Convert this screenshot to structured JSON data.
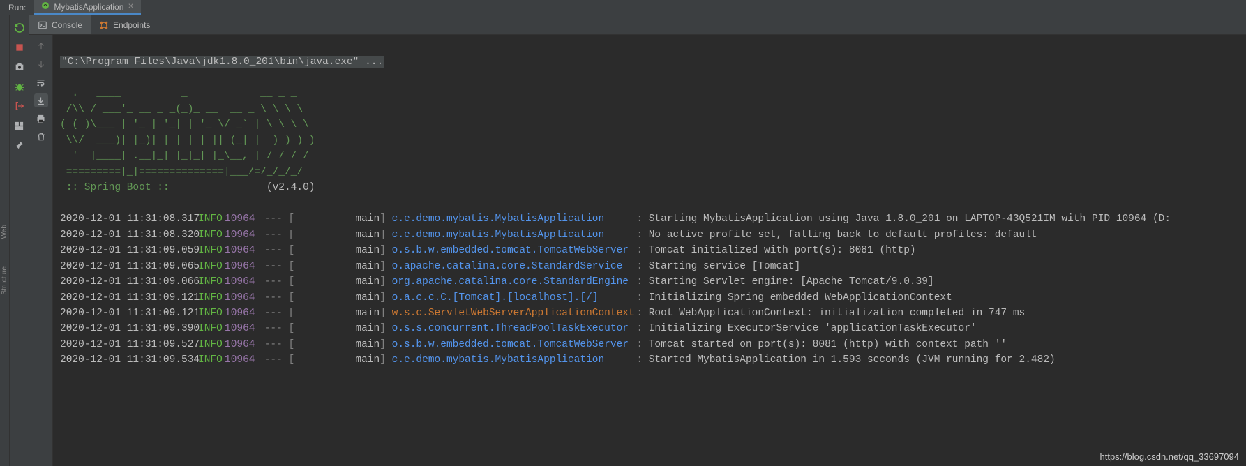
{
  "topbar": {
    "run_label": "Run:",
    "tab_title": "MybatisApplication",
    "tab_close": "×"
  },
  "subtabs": {
    "console": "Console",
    "endpoints": "Endpoints"
  },
  "console": {
    "command": "\"C:\\Program Files\\Java\\jdk1.8.0_201\\bin\\java.exe\" ...",
    "banner_line1": "  .   ____          _            __ _ _",
    "banner_line2": " /\\\\ / ___'_ __ _ _(_)_ __  __ _ \\ \\ \\ \\",
    "banner_line3": "( ( )\\___ | '_ | '_| | '_ \\/ _` | \\ \\ \\ \\",
    "banner_line4": " \\\\/  ___)| |_)| | | | | || (_| |  ) ) ) )",
    "banner_line5": "  '  |____| .__|_| |_|_| |_\\__, | / / / /",
    "banner_line6": " =========|_|==============|___/=/_/_/_/",
    "spring_label": " :: Spring Boot ::",
    "version_label": "                (v2.4.0)"
  },
  "logs": [
    {
      "ts": "2020-12-01 11:31:08.317",
      "level": "INFO",
      "pid": "10964",
      "thread": "main",
      "logger": "c.e.demo.mybatis.MybatisApplication",
      "msg": "Starting MybatisApplication using Java 1.8.0_201 on LAPTOP-43Q521IM with PID 10964 (D:"
    },
    {
      "ts": "2020-12-01 11:31:08.320",
      "level": "INFO",
      "pid": "10964",
      "thread": "main",
      "logger": "c.e.demo.mybatis.MybatisApplication",
      "msg": "No active profile set, falling back to default profiles: default"
    },
    {
      "ts": "2020-12-01 11:31:09.059",
      "level": "INFO",
      "pid": "10964",
      "thread": "main",
      "logger": "o.s.b.w.embedded.tomcat.TomcatWebServer",
      "msg": "Tomcat initialized with port(s): 8081 (http)"
    },
    {
      "ts": "2020-12-01 11:31:09.065",
      "level": "INFO",
      "pid": "10964",
      "thread": "main",
      "logger": "o.apache.catalina.core.StandardService",
      "msg": "Starting service [Tomcat]"
    },
    {
      "ts": "2020-12-01 11:31:09.066",
      "level": "INFO",
      "pid": "10964",
      "thread": "main",
      "logger": "org.apache.catalina.core.StandardEngine",
      "msg": "Starting Servlet engine: [Apache Tomcat/9.0.39]"
    },
    {
      "ts": "2020-12-01 11:31:09.121",
      "level": "INFO",
      "pid": "10964",
      "thread": "main",
      "logger": "o.a.c.c.C.[Tomcat].[localhost].[/]",
      "msg": "Initializing Spring embedded WebApplicationContext"
    },
    {
      "ts": "2020-12-01 11:31:09.121",
      "level": "INFO",
      "pid": "10964",
      "thread": "main",
      "logger": "w.s.c.ServletWebServerApplicationContext",
      "alt": true,
      "msg": "Root WebApplicationContext: initialization completed in 747 ms"
    },
    {
      "ts": "2020-12-01 11:31:09.390",
      "level": "INFO",
      "pid": "10964",
      "thread": "main",
      "logger": "o.s.s.concurrent.ThreadPoolTaskExecutor",
      "msg": "Initializing ExecutorService 'applicationTaskExecutor'"
    },
    {
      "ts": "2020-12-01 11:31:09.527",
      "level": "INFO",
      "pid": "10964",
      "thread": "main",
      "logger": "o.s.b.w.embedded.tomcat.TomcatWebServer",
      "msg": "Tomcat started on port(s): 8081 (http) with context path ''"
    },
    {
      "ts": "2020-12-01 11:31:09.534",
      "level": "INFO",
      "pid": "10964",
      "thread": "main",
      "logger": "c.e.demo.mybatis.MybatisApplication",
      "msg": "Started MybatisApplication in 1.593 seconds (JVM running for 2.482)"
    }
  ],
  "watermark": "https://blog.csdn.net/qq_33697094",
  "sidebar_labels": {
    "web": "Web",
    "structure": "Structure"
  }
}
